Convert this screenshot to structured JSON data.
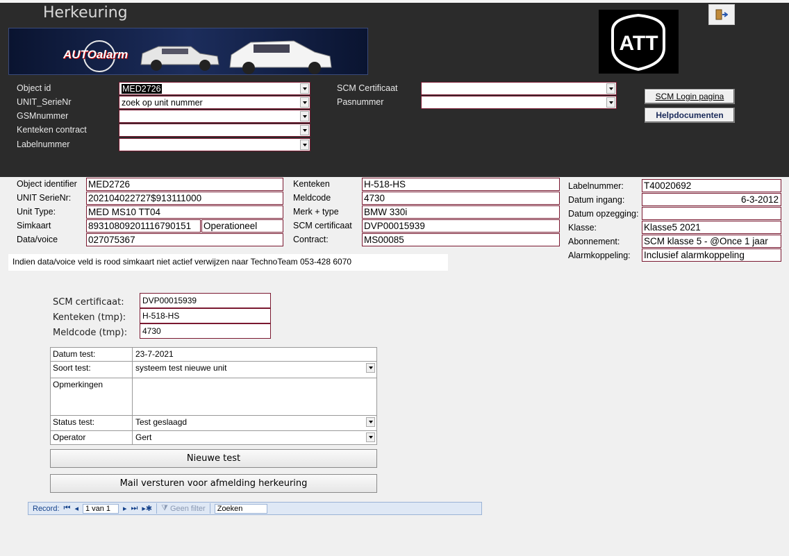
{
  "window": {
    "title": "Herkeuring"
  },
  "banner": {
    "brand": "AUTOalarm"
  },
  "logo": {
    "text": "ATT"
  },
  "lookup": {
    "object_id": {
      "label": "Object id",
      "value": "MED2726"
    },
    "unit_serienr": {
      "label": "UNIT_SerieNr",
      "value": "zoek op unit nummer"
    },
    "gsmnummer": {
      "label": "GSMnummer",
      "value": ""
    },
    "kenteken_contract": {
      "label": "Kenteken contract",
      "value": ""
    },
    "labelnummer": {
      "label": "Labelnummer",
      "value": ""
    },
    "scm_certificaat": {
      "label": "SCM Certificaat",
      "value": ""
    },
    "pasnummer": {
      "label": "Pasnummer",
      "value": ""
    }
  },
  "buttons": {
    "scm_login": "SCM Login pagina",
    "help": "Helpdocumenten",
    "nieuwe_test": "Nieuwe test",
    "mail": "Mail versturen voor afmelding herkeuring"
  },
  "info": {
    "object_identifier": {
      "label": "Object identifier",
      "value": "MED2726"
    },
    "unit_serienr": {
      "label": "UNIT SerieNr:",
      "value": "202104022727$913111000"
    },
    "unit_type": {
      "label": "Unit Type:",
      "value": "MED MS10 TT04"
    },
    "simkaart": {
      "label": "Simkaart",
      "value": "89310809201116790151",
      "status": "Operationeel"
    },
    "data_voice": {
      "label": "Data/voice",
      "value": "027075367"
    },
    "kenteken": {
      "label": "Kenteken",
      "value": "H-518-HS"
    },
    "meldcode": {
      "label": "Meldcode",
      "value": "4730"
    },
    "merk_type": {
      "label": "Merk + type",
      "value": "BMW 330i"
    },
    "scm_certificaat": {
      "label": "SCM certificaat",
      "value": "DVP00015939"
    },
    "contract": {
      "label": "Contract:",
      "value": "MS00085"
    },
    "labelnummer": {
      "label": "Labelnummer:",
      "value": "T40020692"
    },
    "datum_ingang": {
      "label": "Datum ingang:",
      "value": "6-3-2012"
    },
    "datum_opzegging": {
      "label": "Datum opzegging:",
      "value": ""
    },
    "klasse": {
      "label": "Klasse:",
      "value": "Klasse5 2021"
    },
    "abonnement": {
      "label": "Abonnement:",
      "value": "SCM klasse 5 - @Once 1 jaar"
    },
    "alarmkoppeling": {
      "label": "Alarmkoppeling:",
      "value": "Inclusief alarmkoppeling"
    },
    "note": "Indien data/voice veld is rood simkaart niet actief verwijzen naar TechnoTeam 053-428 6070"
  },
  "test_header": {
    "scm": {
      "label": "SCM certificaat:",
      "value": "DVP00015939"
    },
    "kenteken": {
      "label": "Kenteken (tmp):",
      "value": "H-518-HS"
    },
    "meldcode": {
      "label": "Meldcode (tmp):",
      "value": "4730"
    }
  },
  "test": {
    "datum": {
      "label": "Datum test:",
      "value": "23-7-2021"
    },
    "soort": {
      "label": "Soort test:",
      "value": "systeem test nieuwe unit"
    },
    "opmerkingen": {
      "label": "Opmerkingen",
      "value": ""
    },
    "status": {
      "label": "Status test:",
      "value": "Test geslaagd"
    },
    "operator": {
      "label": "Operator",
      "value": "Gert"
    }
  },
  "recordnav": {
    "label": "Record:",
    "current": "1 van 1",
    "filter": "Geen filter",
    "search": "Zoeken"
  }
}
